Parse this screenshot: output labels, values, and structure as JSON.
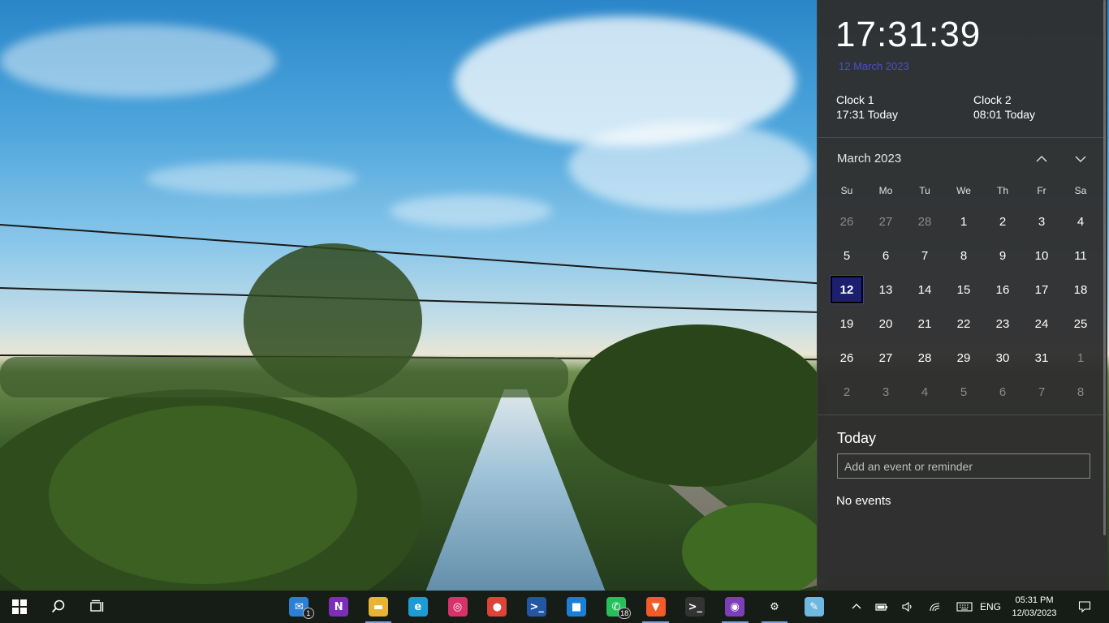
{
  "flyout": {
    "time": "17:31:39",
    "long_date": "12 March 2023",
    "clocks": [
      {
        "name": "Clock 1",
        "detail": "17:31 Today"
      },
      {
        "name": "Clock 2",
        "detail": "08:01 Today"
      }
    ],
    "calendar": {
      "month_title": "March 2023",
      "weekdays": [
        "Su",
        "Mo",
        "Tu",
        "We",
        "Th",
        "Fr",
        "Sa"
      ],
      "days": [
        {
          "n": "26",
          "other": true
        },
        {
          "n": "27",
          "other": true
        },
        {
          "n": "28",
          "other": true
        },
        {
          "n": "1"
        },
        {
          "n": "2"
        },
        {
          "n": "3"
        },
        {
          "n": "4"
        },
        {
          "n": "5"
        },
        {
          "n": "6"
        },
        {
          "n": "7"
        },
        {
          "n": "8"
        },
        {
          "n": "9"
        },
        {
          "n": "10"
        },
        {
          "n": "11"
        },
        {
          "n": "12",
          "today": true
        },
        {
          "n": "13"
        },
        {
          "n": "14"
        },
        {
          "n": "15"
        },
        {
          "n": "16"
        },
        {
          "n": "17"
        },
        {
          "n": "18"
        },
        {
          "n": "19"
        },
        {
          "n": "20"
        },
        {
          "n": "21"
        },
        {
          "n": "22"
        },
        {
          "n": "23"
        },
        {
          "n": "24"
        },
        {
          "n": "25"
        },
        {
          "n": "26"
        },
        {
          "n": "27"
        },
        {
          "n": "28"
        },
        {
          "n": "29"
        },
        {
          "n": "30"
        },
        {
          "n": "31"
        },
        {
          "n": "1",
          "other": true
        },
        {
          "n": "2",
          "other": true
        },
        {
          "n": "3",
          "other": true
        },
        {
          "n": "4",
          "other": true
        },
        {
          "n": "5",
          "other": true
        },
        {
          "n": "6",
          "other": true
        },
        {
          "n": "7",
          "other": true
        },
        {
          "n": "8",
          "other": true
        }
      ],
      "prev_icon": "chevron-up-icon",
      "next_icon": "chevron-down-icon"
    },
    "agenda": {
      "title": "Today",
      "input_placeholder": "Add an event or reminder",
      "empty_text": "No events"
    }
  },
  "taskbar": {
    "left": [
      {
        "name": "start",
        "icon": "windows-logo-icon"
      },
      {
        "name": "search",
        "icon": "search-icon"
      },
      {
        "name": "task-view",
        "icon": "task-view-icon"
      }
    ],
    "apps": [
      {
        "name": "mail",
        "glyph": "✉",
        "color": "#2d7fd6",
        "badge": "1",
        "running": false
      },
      {
        "name": "onenote",
        "glyph": "N",
        "color": "#7b2fb8",
        "badge": "",
        "running": false
      },
      {
        "name": "file-explorer",
        "glyph": "▬",
        "color": "#e8b434",
        "badge": "",
        "running": true
      },
      {
        "name": "edge",
        "glyph": "e",
        "color": "#1d9bd6",
        "badge": "",
        "running": false
      },
      {
        "name": "instagram",
        "glyph": "◎",
        "color": "#d6336c",
        "badge": "",
        "running": false
      },
      {
        "name": "chrome",
        "glyph": "●",
        "color": "#db4437",
        "badge": "",
        "running": false
      },
      {
        "name": "powershell",
        "glyph": ">_",
        "color": "#2456a6",
        "badge": "",
        "running": false
      },
      {
        "name": "store",
        "glyph": "■",
        "color": "#1b7fd8",
        "badge": "",
        "running": false
      },
      {
        "name": "whatsapp",
        "glyph": "✆",
        "color": "#25c05b",
        "badge": "18",
        "running": false
      },
      {
        "name": "brave",
        "glyph": "▼",
        "color": "#f25a28",
        "badge": "",
        "running": true
      },
      {
        "name": "terminal",
        "glyph": ">_",
        "color": "#333333",
        "badge": "",
        "running": false
      },
      {
        "name": "github-desktop",
        "glyph": "◉",
        "color": "#7c3fb8",
        "badge": "",
        "running": true
      },
      {
        "name": "settings",
        "glyph": "⚙",
        "color": "transparent",
        "badge": "",
        "running": true
      },
      {
        "name": "paint",
        "glyph": "✎",
        "color": "#6fb8e0",
        "badge": "",
        "running": false
      }
    ],
    "tray": {
      "overflow_icon": "chevron-up-icon",
      "battery_icon": "battery-icon",
      "volume_icon": "volume-icon",
      "network_icon": "wifi-icon",
      "keyboard_icon": "keyboard-icon",
      "language": "ENG",
      "time": "05:31 PM",
      "date": "12/03/2023",
      "notification_icon": "notification-icon"
    }
  }
}
